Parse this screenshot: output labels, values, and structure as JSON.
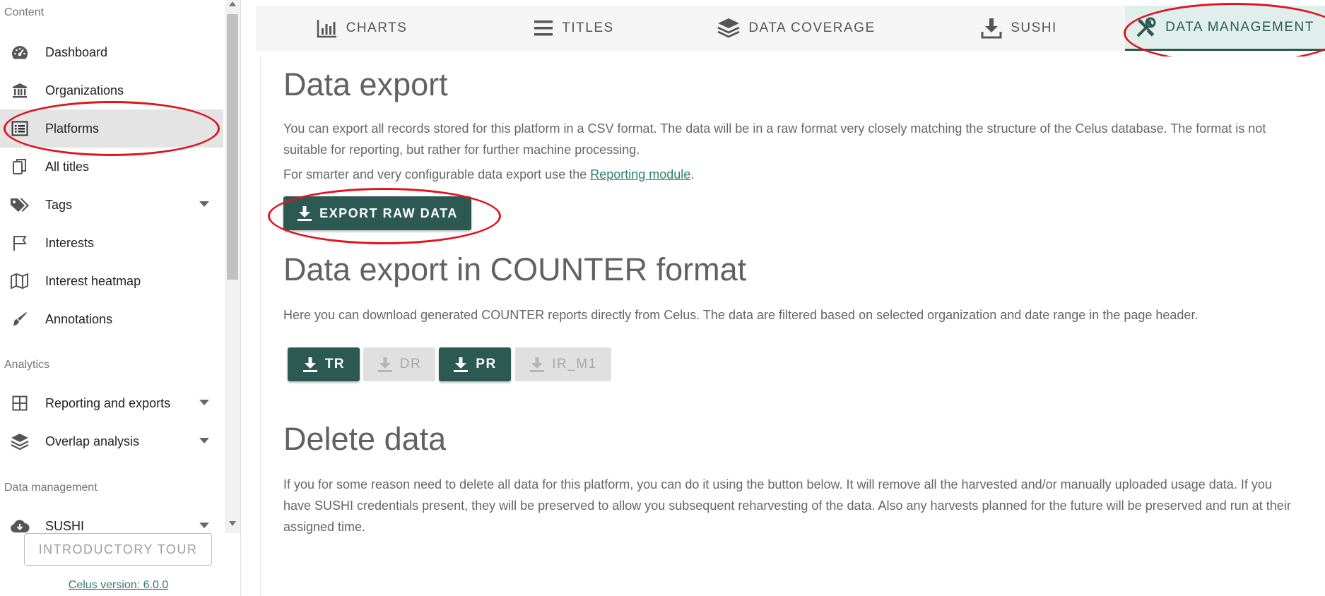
{
  "sidebar": {
    "sections": {
      "content": "Content",
      "analytics": "Analytics",
      "data_management": "Data management"
    },
    "items": [
      {
        "label": "Dashboard",
        "icon": "dashboard-icon"
      },
      {
        "label": "Organizations",
        "icon": "bank-icon"
      },
      {
        "label": "Platforms",
        "icon": "list-icon",
        "active": true
      },
      {
        "label": "All titles",
        "icon": "copy-icon"
      },
      {
        "label": "Tags",
        "icon": "tags-icon",
        "expandable": true
      },
      {
        "label": "Interests",
        "icon": "flag-icon"
      },
      {
        "label": "Interest heatmap",
        "icon": "map-icon"
      },
      {
        "label": "Annotations",
        "icon": "brush-icon"
      },
      {
        "label": "Reporting and exports",
        "icon": "grid-icon",
        "expandable": true
      },
      {
        "label": "Overlap analysis",
        "icon": "layers-icon",
        "expandable": true
      },
      {
        "label": "SUSHI",
        "icon": "cloud-download-icon",
        "expandable": true
      }
    ],
    "intro_button": "INTRODUCTORY TOUR",
    "version_link": "Celus version: 6.0.0"
  },
  "tabs": [
    {
      "label": "CHARTS",
      "icon": "bar-chart-icon"
    },
    {
      "label": "TITLES",
      "icon": "menu-icon"
    },
    {
      "label": "DATA COVERAGE",
      "icon": "layers-icon"
    },
    {
      "label": "SUSHI",
      "icon": "download-tray-icon"
    },
    {
      "label": "DATA MANAGEMENT",
      "icon": "tools-icon",
      "active": true
    }
  ],
  "main": {
    "export": {
      "title": "Data export",
      "para1": "You can export all records stored for this platform in a CSV format. The data will be in a raw format very closely matching the structure of the Celus database. The format is not suitable for reporting, but rather for further machine processing.",
      "para2_prefix": "For smarter and very configurable data export use the ",
      "para2_link": "Reporting module",
      "para2_suffix": ".",
      "button": "EXPORT RAW DATA"
    },
    "counter": {
      "title": "Data export in COUNTER format",
      "para": "Here you can download generated COUNTER reports directly from Celus. The data are filtered based on selected organization and date range in the page header.",
      "buttons": [
        {
          "label": "TR",
          "enabled": true
        },
        {
          "label": "DR",
          "enabled": false
        },
        {
          "label": "PR",
          "enabled": true
        },
        {
          "label": "IR_M1",
          "enabled": false
        }
      ]
    },
    "delete": {
      "title": "Delete data",
      "para": "If you for some reason need to delete all data for this platform, you can do it using the button below. It will remove all the harvested and/or manually uploaded usage data. If you have SUSHI credentials present, they will be preserved to allow you subsequent reharvesting of the data. Also any harvests planned for the future will be preserved and run at their assigned time."
    }
  },
  "colors": {
    "primary": "#2c5a52",
    "active_tab_bg": "#e1efec",
    "annotation": "#e0141e",
    "link": "#2e7d6e"
  }
}
